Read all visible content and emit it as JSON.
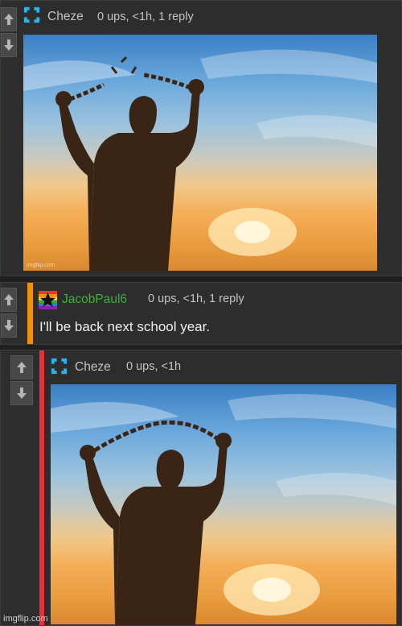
{
  "comments": [
    {
      "username": "Cheze",
      "user_color": "#c4c4c4",
      "meta": "0 ups, <1h, 1 reply",
      "image_watermark": "imgflip.com"
    },
    {
      "username": "JacobPaul6",
      "user_color": "#3fae3f",
      "meta": "0 ups, <1h, 1 reply",
      "text": "I'll be back next school year."
    },
    {
      "username": "Cheze",
      "user_color": "#c4c4c4",
      "meta": "0 ups, <1h",
      "image_watermark": "imgflip.com"
    }
  ],
  "footer_watermark": "imgflip.com",
  "colors": {
    "stripe_orange": "#f0900f",
    "stripe_red": "#e8303a",
    "cheze_icon": "#2ab4e8"
  },
  "icons": {
    "upvote": "arrow-up-icon",
    "downvote": "arrow-down-icon",
    "cheze_avatar": "bracket-square-icon",
    "jacob_avatar": "rainbow-star-icon"
  }
}
